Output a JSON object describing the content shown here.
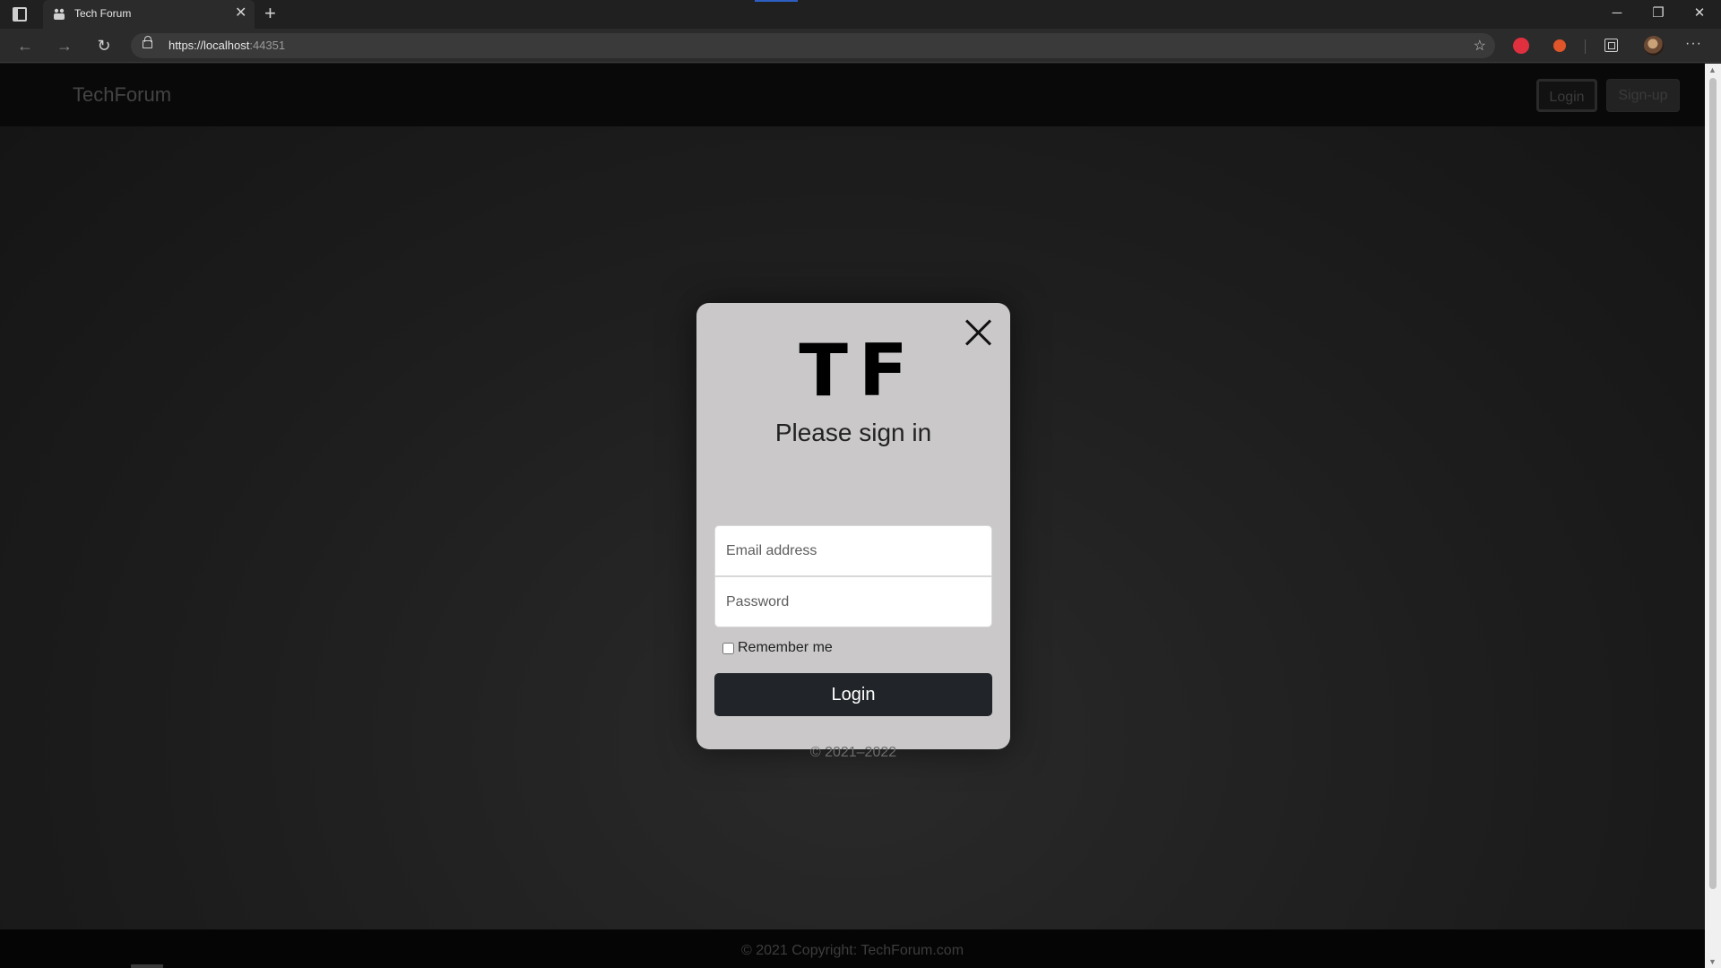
{
  "browser": {
    "tab_title": "Tech Forum",
    "tab_close": "✕",
    "new_tab": "+",
    "url_host": "https://localhost",
    "url_port": ":44351",
    "window_controls": {
      "minimize": "─",
      "restore": "❐",
      "close": "✕"
    },
    "extensions": [
      {
        "icon": "extension-red-icon",
        "color": "#e0303f"
      },
      {
        "icon": "extension-orange-icon",
        "color": "#e0552a"
      }
    ],
    "more": "···"
  },
  "navbar": {
    "brand": "TechForum",
    "login_label": "Login",
    "signup_label": "Sign-up"
  },
  "modal": {
    "logo": "TF",
    "heading": "Please sign in",
    "email_placeholder": "Email address",
    "password_placeholder": "Password",
    "remember_label": "Remember me",
    "remember_checked": false,
    "login_label": "Login",
    "copyright": "© 2021–2022"
  },
  "footer": {
    "text": "© 2021 Copyright: TechForum.com"
  },
  "colors": {
    "modal_bg": "#cac8c9",
    "button_bg": "#212529",
    "page_bg": "#1d1d1d"
  }
}
